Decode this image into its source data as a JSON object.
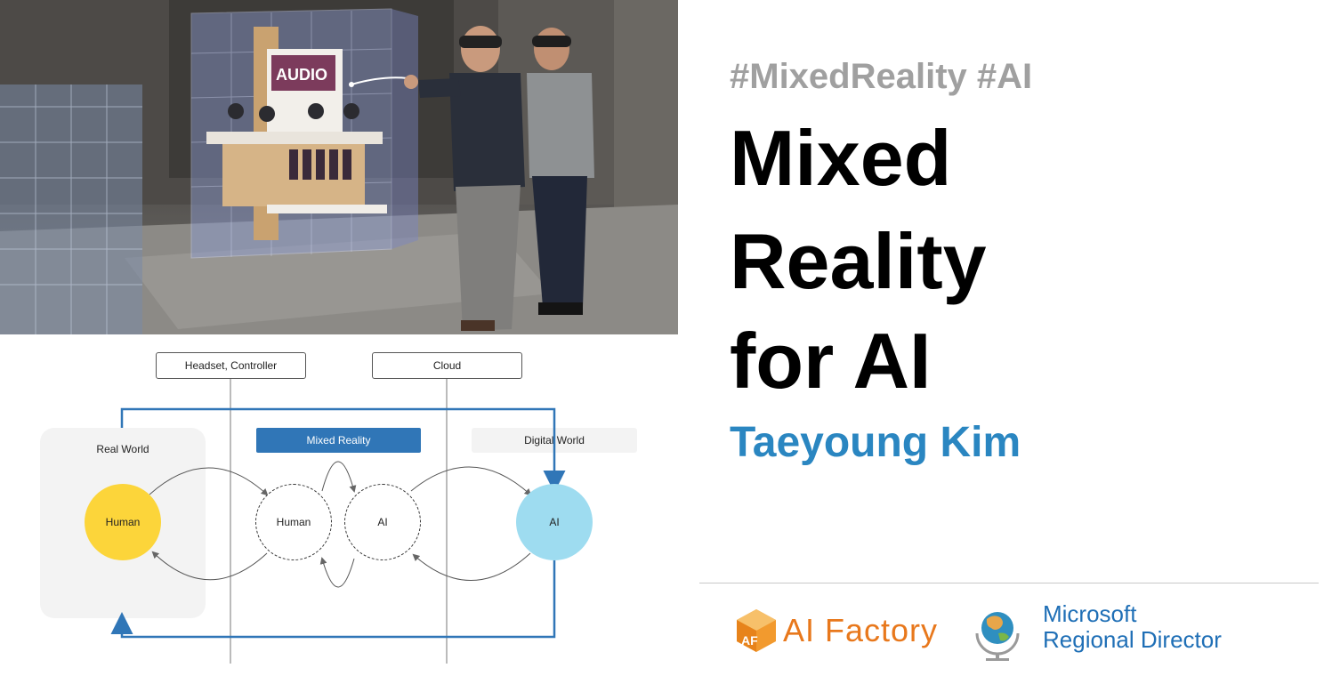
{
  "photo": {
    "sign_text": "AUDIO"
  },
  "diagram": {
    "headset_box": "Headset, Controller",
    "cloud_box": "Cloud",
    "real_world": "Real World",
    "mixed_reality": "Mixed Reality",
    "digital_world": "Digital World",
    "human_real": "Human",
    "human_mixed": "Human",
    "ai_mixed": "AI",
    "ai_digital": "AI",
    "colors": {
      "human": "#fcd53a",
      "ai": "#9edcf0",
      "mixed_bar": "#3076b7",
      "arrow": "#3076b7"
    }
  },
  "hashtags": "#MixedReality #AI",
  "title": {
    "line1": "Mixed",
    "line2": "Reality",
    "line3": "for AI"
  },
  "author": "Taeyoung Kim",
  "footer": {
    "ai_factory": "AI Factory",
    "ai_factory_mark": "AF",
    "ms_line1": "Microsoft",
    "ms_line2": "Regional Director"
  }
}
